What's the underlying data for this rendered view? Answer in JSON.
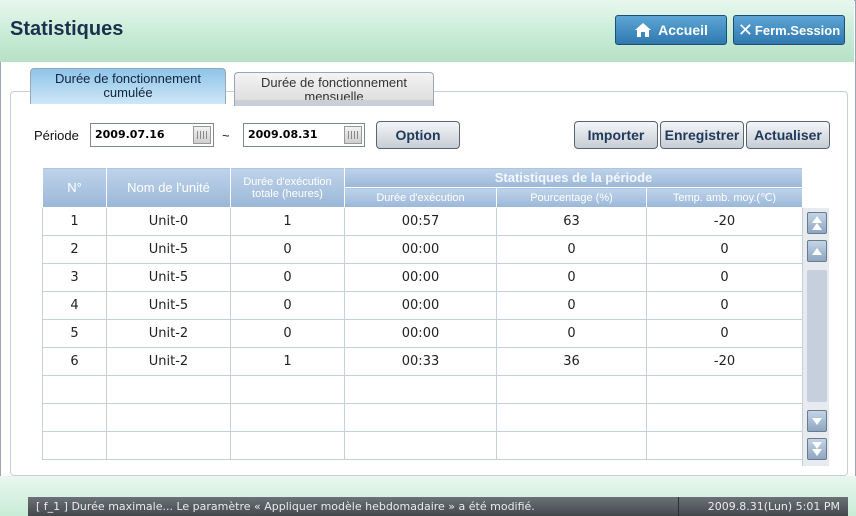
{
  "header": {
    "title": "Statistiques",
    "home_label": "Accueil",
    "close_label": "Ferm.Session"
  },
  "tabs": [
    {
      "line1": "Durée de fonctionnement",
      "line2": "cumulée"
    },
    {
      "line1": "Durée de fonctionnement",
      "line2": "mensuelle"
    }
  ],
  "filter": {
    "period_label": "Période",
    "start_date": "2009.07.16",
    "separator": "~",
    "end_date": "2009.08.31",
    "option_label": "Option"
  },
  "actions": {
    "import_label": "Importer",
    "save_label": "Enregistrer",
    "refresh_label": "Actualiser"
  },
  "table": {
    "headers": {
      "num": "N°",
      "unit": "Nom de l'unité",
      "total_line1": "Durée d'exécution",
      "total_line2": "totale (heures)",
      "group": "Statistiques de la période",
      "duration": "Durée d'exécution",
      "percent": "Pourcentage (%)",
      "temp": "Temp. amb. moy.(℃)"
    },
    "rows": [
      {
        "num": "1",
        "unit": "Unit-0",
        "total": "1",
        "duration": "00:57",
        "percent": "63",
        "temp": "-20"
      },
      {
        "num": "2",
        "unit": "Unit-5",
        "total": "0",
        "duration": "00:00",
        "percent": "0",
        "temp": "0"
      },
      {
        "num": "3",
        "unit": "Unit-5",
        "total": "0",
        "duration": "00:00",
        "percent": "0",
        "temp": "0"
      },
      {
        "num": "4",
        "unit": "Unit-5",
        "total": "0",
        "duration": "00:00",
        "percent": "0",
        "temp": "0"
      },
      {
        "num": "5",
        "unit": "Unit-2",
        "total": "0",
        "duration": "00:00",
        "percent": "0",
        "temp": "0"
      },
      {
        "num": "6",
        "unit": "Unit-2",
        "total": "1",
        "duration": "00:33",
        "percent": "36",
        "temp": "-20"
      },
      {
        "num": "",
        "unit": "",
        "total": "",
        "duration": "",
        "percent": "",
        "temp": ""
      },
      {
        "num": "",
        "unit": "",
        "total": "",
        "duration": "",
        "percent": "",
        "temp": ""
      },
      {
        "num": "",
        "unit": "",
        "total": "",
        "duration": "",
        "percent": "",
        "temp": ""
      }
    ]
  },
  "status": {
    "message": "[ f_1 ] Durée maximale... Le paramètre « Appliquer modèle hebdomadaire » a été modifié.",
    "datetime": "2009.8.31(Lun)  5:01 PM"
  },
  "icons": {
    "home": "home-icon",
    "close": "close-icon",
    "calendar": "calendar-icon",
    "scroll_top": "double-up-icon",
    "scroll_up": "up-icon",
    "scroll_down": "down-icon",
    "scroll_bottom": "double-down-icon"
  },
  "colors": {
    "accent": "#2f79b0",
    "header_bg": "#c8ecd6",
    "table_header": "#9ab7d8"
  }
}
